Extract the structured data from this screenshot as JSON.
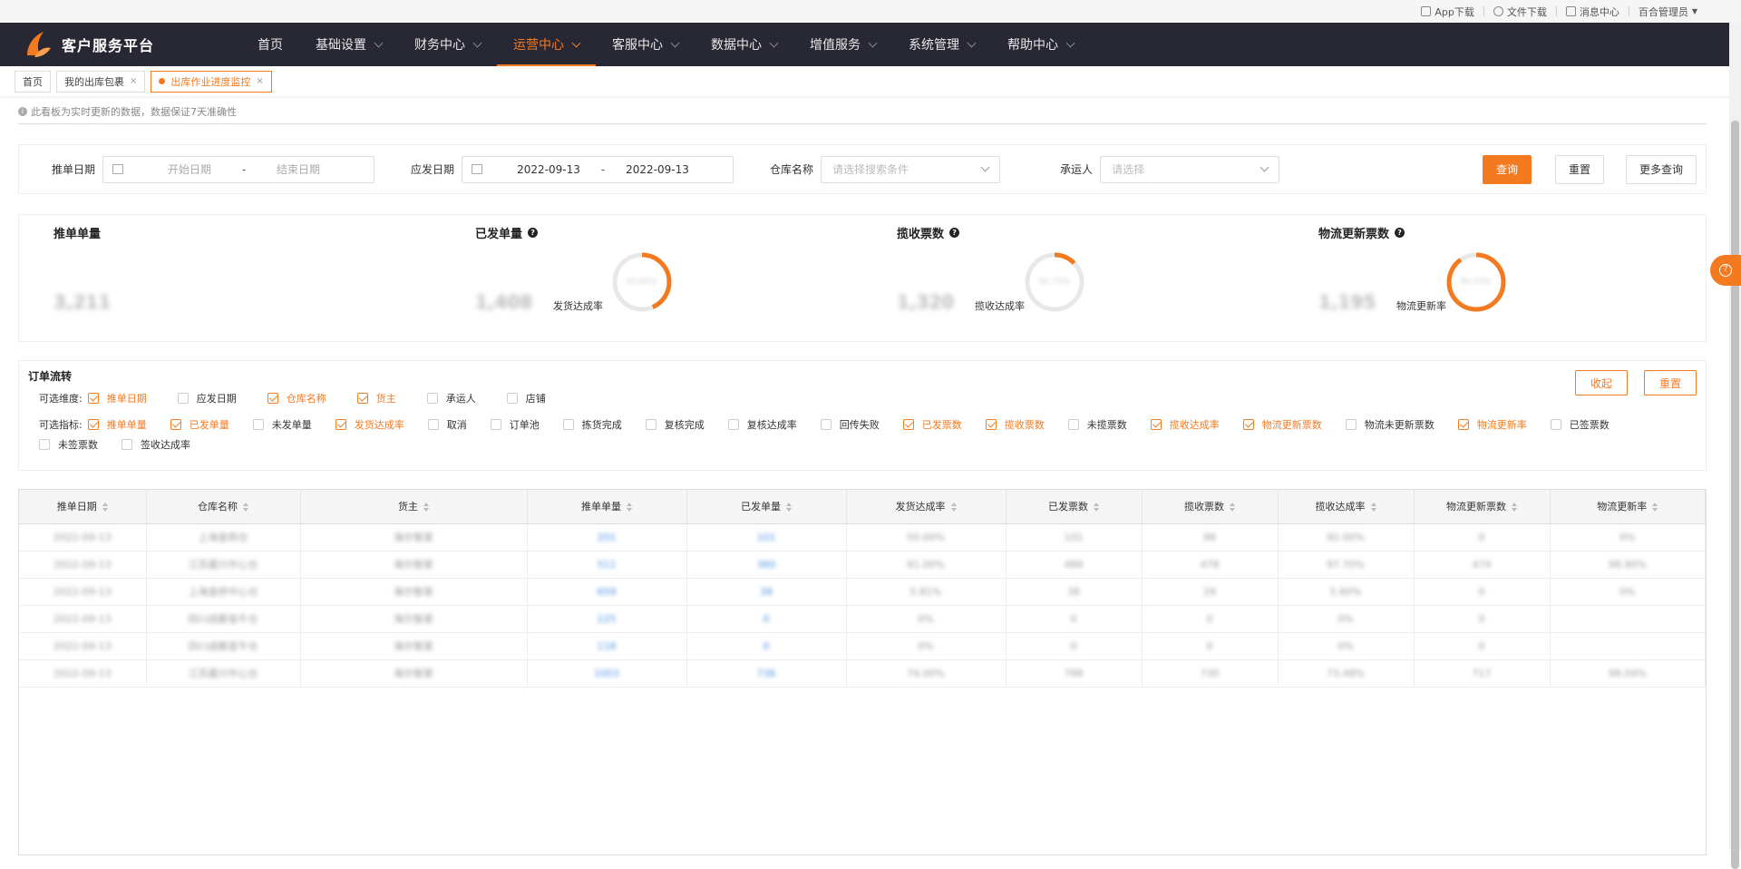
{
  "util_bar": {
    "app_download": "App下载",
    "file_download": "文件下载",
    "messages": "消息中心",
    "user": "百合管理员"
  },
  "brand": {
    "title": "客户服务平台",
    "accent_color": "#f47a20",
    "nav_bg": "#272833"
  },
  "nav": {
    "items": [
      {
        "label": "首页",
        "has_menu": false
      },
      {
        "label": "基础设置",
        "has_menu": true
      },
      {
        "label": "财务中心",
        "has_menu": true
      },
      {
        "label": "运营中心",
        "has_menu": true,
        "active": true
      },
      {
        "label": "客服中心",
        "has_menu": true
      },
      {
        "label": "数据中心",
        "has_menu": true
      },
      {
        "label": "增值服务",
        "has_menu": true
      },
      {
        "label": "系统管理",
        "has_menu": true
      },
      {
        "label": "帮助中心",
        "has_menu": true
      }
    ]
  },
  "tabs": [
    {
      "label": "首页"
    },
    {
      "label": "我的出库包裹"
    },
    {
      "label": "出库作业进度监控",
      "active": true
    }
  ],
  "notice": "此看板为实时更新的数据，数据保证7天准确性",
  "filters": {
    "push_date_label": "推单日期",
    "push_date_start_placeholder": "开始日期",
    "push_date_end_placeholder": "结束日期",
    "ship_date_label": "应发日期",
    "ship_date_start": "2022-09-13",
    "ship_date_end": "2022-09-13",
    "warehouse_label": "仓库名称",
    "warehouse_placeholder": "请选择搜索条件",
    "carrier_label": "承运人",
    "carrier_placeholder": "请选择",
    "query": "查询",
    "reset": "重置",
    "more": "更多查询"
  },
  "stats": {
    "push": {
      "title": "推单单量",
      "value": "3,211"
    },
    "shipped": {
      "title": "已发单量",
      "value": "1,408",
      "rate_label": "发货达成率",
      "rate": "43.85%"
    },
    "collected": {
      "title": "揽收票数",
      "value": "1,320",
      "rate_label": "揽收达成率",
      "rate": "93.75%"
    },
    "logistics": {
      "title": "物流更新票数",
      "value": "1,195",
      "rate_label": "物流更新率",
      "rate": "90.53%"
    }
  },
  "flow": {
    "title": "订单流转",
    "collapse": "收起",
    "reset": "重置",
    "dimensions_label": "可选维度:",
    "dimensions": [
      {
        "label": "推单日期",
        "checked": true
      },
      {
        "label": "应发日期",
        "checked": false
      },
      {
        "label": "仓库名称",
        "checked": true
      },
      {
        "label": "货主",
        "checked": true
      },
      {
        "label": "承运人",
        "checked": false
      },
      {
        "label": "店铺",
        "checked": false
      }
    ],
    "metrics_label": "可选指标:",
    "metrics": [
      {
        "label": "推单单量",
        "checked": true
      },
      {
        "label": "已发单量",
        "checked": true
      },
      {
        "label": "未发单量",
        "checked": false
      },
      {
        "label": "发货达成率",
        "checked": true
      },
      {
        "label": "取消",
        "checked": false
      },
      {
        "label": "订单池",
        "checked": false
      },
      {
        "label": "拣货完成",
        "checked": false
      },
      {
        "label": "复核完成",
        "checked": false
      },
      {
        "label": "复核达成率",
        "checked": false
      },
      {
        "label": "回传失败",
        "checked": false
      },
      {
        "label": "已发票数",
        "checked": true
      },
      {
        "label": "揽收票数",
        "checked": true
      },
      {
        "label": "未揽票数",
        "checked": false
      },
      {
        "label": "揽收达成率",
        "checked": true
      },
      {
        "label": "物流更新票数",
        "checked": true
      },
      {
        "label": "物流未更新票数",
        "checked": false
      },
      {
        "label": "物流更新率",
        "checked": true
      },
      {
        "label": "已签票数",
        "checked": false
      },
      {
        "label": "未签票数",
        "checked": false
      },
      {
        "label": "签收达成率",
        "checked": false
      }
    ]
  },
  "table": {
    "columns": [
      "推单日期",
      "仓库名称",
      "货主",
      "推单单量",
      "已发单量",
      "发货达成率",
      "已发票数",
      "揽收票数",
      "揽收达成率",
      "物流更新票数",
      "物流更新率"
    ],
    "rows": [
      [
        "2022-09-13",
        "上海金桥仓",
        "海尔智家",
        "201",
        "101",
        "50.00%",
        "101",
        "98",
        "92.00%",
        "0",
        "0%"
      ],
      [
        "2022-09-13",
        "江苏嘉兴中心仓",
        "海尔智家",
        "511",
        "360",
        "91.00%",
        "489",
        "478",
        "97.70%",
        "474",
        "98.90%"
      ],
      [
        "2022-09-13",
        "上海金桥中心仓",
        "海尔智家",
        "659",
        "38",
        "5.81%",
        "38",
        "29",
        "5.60%",
        "0",
        "0%"
      ],
      [
        "2022-09-13",
        "四川成都金牛仓",
        "海尔智家",
        "225",
        "0",
        "0%",
        "0",
        "0",
        "0%",
        "0",
        ""
      ],
      [
        "2022-09-13",
        "四川成都金牛仓",
        "海尔智家",
        "118",
        "0",
        "0%",
        "0",
        "0",
        "0%",
        "0",
        ""
      ],
      [
        "2022-09-13",
        "江苏嘉兴中心仓",
        "海尔智家",
        "1003",
        "736",
        "74.00%",
        "798",
        "730",
        "73.48%",
        "717",
        "98.04%"
      ]
    ]
  }
}
